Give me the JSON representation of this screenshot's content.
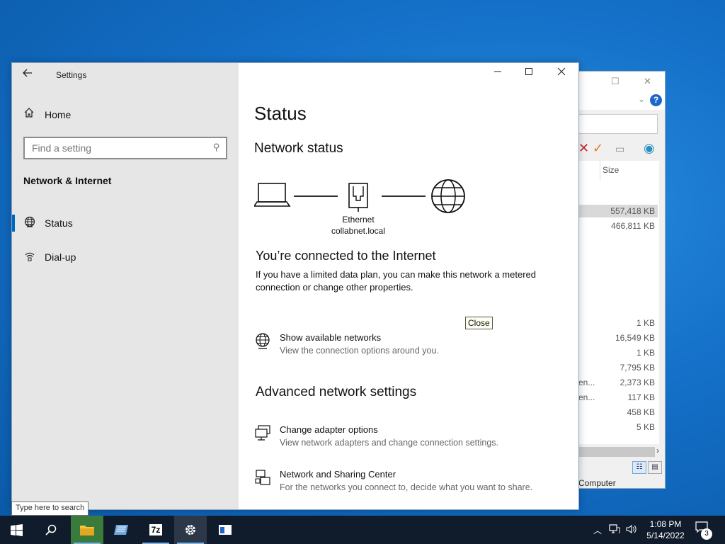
{
  "settings": {
    "app_title": "Settings",
    "home_label": "Home",
    "search_placeholder": "Find a setting",
    "section_title": "Network & Internet",
    "nav": [
      {
        "label": "Status",
        "active": true
      },
      {
        "label": "Dial-up",
        "active": false
      }
    ]
  },
  "main": {
    "page_title": "Status",
    "network_status_heading": "Network status",
    "adapter_name": "Ethernet",
    "network_name": "collabnet.local",
    "connected_title": "You’re connected to the Internet",
    "connected_desc": "If you have a limited data plan, you can make this network a metered connection or change other properties.",
    "tooltip": "Close",
    "show_networks": {
      "title": "Show available networks",
      "desc": "View the connection options around you."
    },
    "advanced_heading": "Advanced network settings",
    "change_adapter": {
      "title": "Change adapter options",
      "desc": "View network adapters and change connection settings."
    },
    "sharing_center": {
      "title": "Network and Sharing Center",
      "desc": "For the networks you connect to, decide what you want to share."
    }
  },
  "background_window": {
    "size_column": "Size",
    "sizes": [
      "557,418 KB",
      "466,811 KB",
      "1 KB",
      "16,549 KB",
      "1 KB",
      "7,795 KB",
      "2,373 KB",
      "117 KB",
      "458 KB",
      "5 KB"
    ],
    "truncated_names": [
      "en...",
      "en..."
    ],
    "status_text": "Computer"
  },
  "taskbar": {
    "search_tip": "Type here to search",
    "time": "1:08 PM",
    "date": "5/14/2022",
    "notification_count": "3",
    "app_7z_label": "7z"
  },
  "colors": {
    "accent": "#0067c0",
    "taskbar": "#101b2b",
    "desktop": "#1470c8"
  }
}
